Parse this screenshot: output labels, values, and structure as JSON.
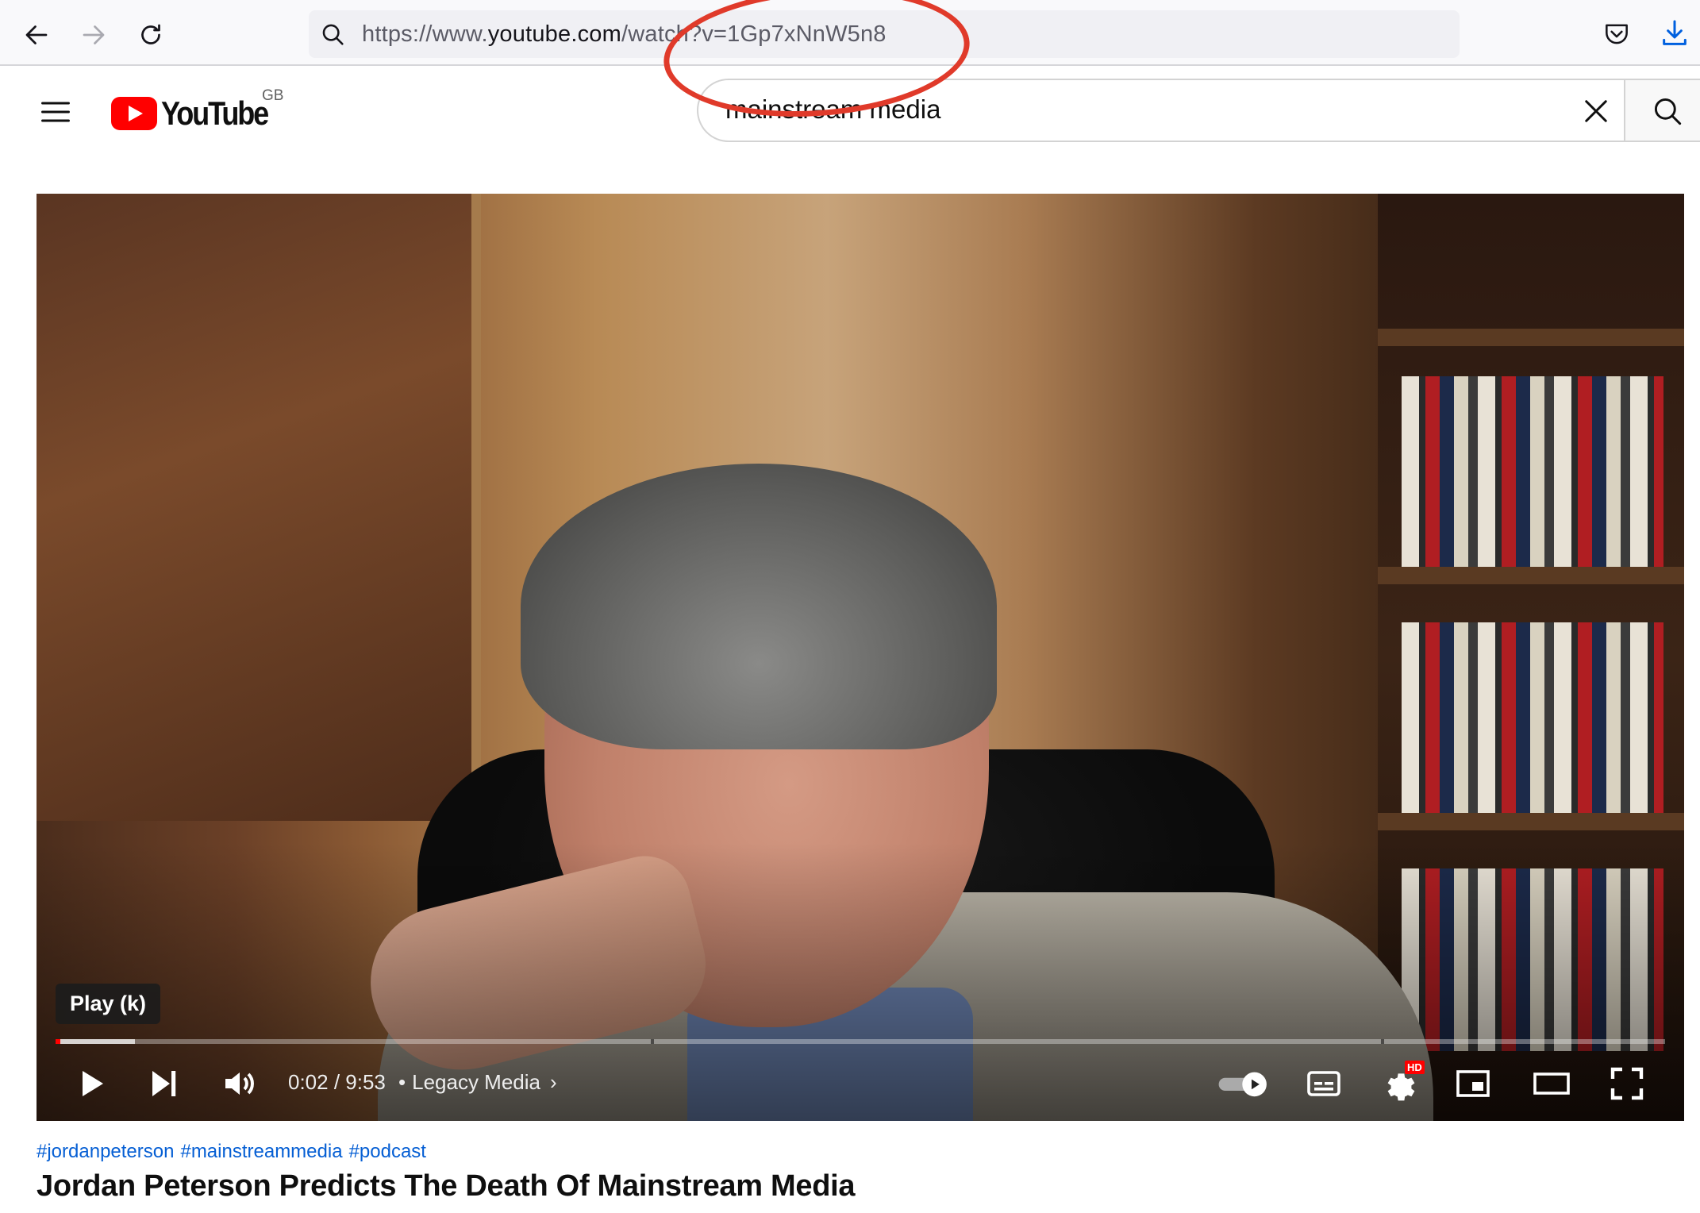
{
  "browser": {
    "url_prefix": "https://www.",
    "url_host": "youtube.com",
    "url_path": "/watch?v=1Gp7xNnW5n8"
  },
  "header": {
    "logo_text": "YouTube",
    "country_code": "GB",
    "search_query": "mainstream media"
  },
  "player": {
    "tooltip": "Play (k)",
    "current_time": "0:02",
    "duration": "9:53",
    "time_separator": " / ",
    "chapter_title": "Legacy Media",
    "progress_fraction": 0.003,
    "hd_badge": "HD"
  },
  "video": {
    "hashtags": [
      "#jordanpeterson",
      "#mainstreammedia",
      "#podcast"
    ],
    "title": "Jordan Peterson Predicts The Death Of Mainstream Media"
  },
  "colors": {
    "annotation": "#e03a2a",
    "youtube_red": "#ff0000",
    "link_blue": "#065fd4"
  }
}
